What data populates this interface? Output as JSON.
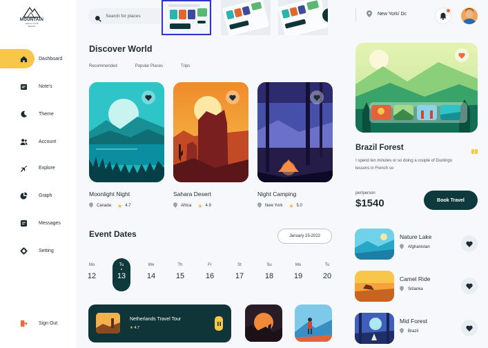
{
  "brand": {
    "name": "MOUNTAIN",
    "line2": "HIKING CLUB",
    "line3": "BRAND"
  },
  "sidebar": {
    "items": [
      {
        "label": "Dashboard",
        "icon": "home-icon"
      },
      {
        "label": "Note's",
        "icon": "notes-icon"
      },
      {
        "label": "Theme",
        "icon": "moon-icon"
      },
      {
        "label": "Account",
        "icon": "users-icon"
      },
      {
        "label": "Explore",
        "icon": "plane-icon"
      },
      {
        "label": "Graph",
        "icon": "pie-icon"
      },
      {
        "label": "Messages",
        "icon": "messages-icon"
      },
      {
        "label": "Setting",
        "icon": "gear-icon"
      }
    ],
    "signout": "Sign Out"
  },
  "search": {
    "placeholder": "Search for places"
  },
  "location": "New York/ Dc",
  "discover": {
    "title": "Discover World",
    "tabs": [
      "Recommended",
      "Popular Places",
      "Trips"
    ],
    "cards": [
      {
        "name": "Moonlight Night",
        "country": "Canada",
        "rating": "4.7"
      },
      {
        "name": "Sahara Desert",
        "country": "Africa",
        "rating": "4.9"
      },
      {
        "name": "Night Camping",
        "country": "New York",
        "rating": "5.0"
      }
    ]
  },
  "events": {
    "title": "Event Dates",
    "date_range": "January 15-2022",
    "days": [
      {
        "name": "Mo",
        "num": "12"
      },
      {
        "name": "Tu",
        "num": "13"
      },
      {
        "name": "We",
        "num": "14"
      },
      {
        "name": "Th",
        "num": "15"
      },
      {
        "name": "Fr",
        "num": "16"
      },
      {
        "name": "St",
        "num": "17"
      },
      {
        "name": "Su",
        "num": "18"
      },
      {
        "name": "Mo",
        "num": "19"
      },
      {
        "name": "Tu",
        "num": "20"
      }
    ],
    "tour": {
      "name": "Netherlands Travel Tour",
      "rating": "4.7"
    }
  },
  "feature": {
    "title": "Brazil Forest",
    "desc": "I spend ten minutes or so doing a couple of Duolingo lessons in French so",
    "per": "per/person",
    "price": "$1540",
    "book": "Book Travel"
  },
  "places": [
    {
      "name": "Nature Lake",
      "loc": "Afghanistan"
    },
    {
      "name": "Camel Ride",
      "loc": "Srilanka"
    },
    {
      "name": "Mid Forest",
      "loc": "Brazil"
    }
  ],
  "colors": {
    "accent": "#f7c64a",
    "dark": "#0f3a3d",
    "selection": "#2f35c8"
  }
}
